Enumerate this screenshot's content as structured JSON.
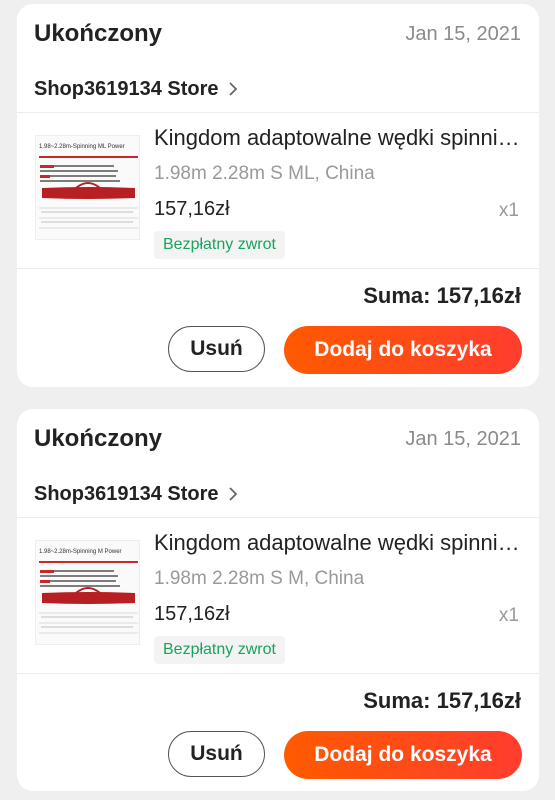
{
  "orders": [
    {
      "status": "Ukończony",
      "date": "Jan 15, 2021",
      "store": "Shop3619134 Store",
      "product": {
        "name": "Kingdom adaptowalne wędki spinningowe",
        "variant": "1.98m 2.28m S ML, China",
        "price": "157,16zł",
        "quantity": "x1",
        "badge": "Bezpłatny zwrot",
        "thumb_title": "1.98~2.28m-Spinning ML Power"
      },
      "total": "Suma: 157,16zł",
      "remove_label": "Usuń",
      "add_label": "Dodaj do koszyka"
    },
    {
      "status": "Ukończony",
      "date": "Jan 15, 2021",
      "store": "Shop3619134 Store",
      "product": {
        "name": "Kingdom adaptowalne wędki spinningowe",
        "variant": "1.98m 2.28m S M, China",
        "price": "157,16zł",
        "quantity": "x1",
        "badge": "Bezpłatny zwrot",
        "thumb_title": "1.98~2.28m-Spinning M Power"
      },
      "total": "Suma: 157,16zł",
      "remove_label": "Usuń",
      "add_label": "Dodaj do koszyka"
    }
  ],
  "colors": {
    "accent": "#ff4f14",
    "badge_text": "#1aa25e",
    "muted": "#999999",
    "background": "#efefef"
  },
  "icons": {
    "store_chevron": "chevron-right-icon"
  }
}
